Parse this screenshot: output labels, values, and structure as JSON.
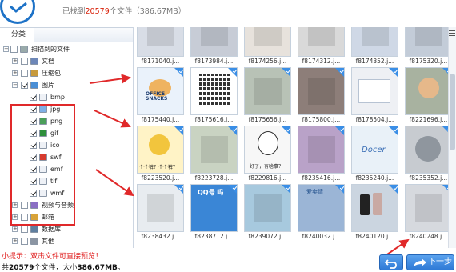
{
  "header": {
    "found_prefix": "已找到",
    "found_count": "20579",
    "found_suffix": "个文件（386.67MB）"
  },
  "sidebar": {
    "tab_label": "分类",
    "root": {
      "label": "扫描到的文件"
    },
    "top_categories": [
      {
        "label": "文档",
        "icon": "document-icon",
        "checked": false
      },
      {
        "label": "压缩包",
        "icon": "archive-icon",
        "checked": false
      },
      {
        "label": "图片",
        "icon": "image-folder-icon",
        "checked": true
      }
    ],
    "image_types": [
      {
        "label": "bmp",
        "icon": "bmp-file-icon",
        "checked": true
      },
      {
        "label": "jpg",
        "icon": "jpg-file-icon",
        "checked": true
      },
      {
        "label": "png",
        "icon": "png-file-icon",
        "checked": true
      },
      {
        "label": "gif",
        "icon": "gif-file-icon",
        "checked": true
      },
      {
        "label": "ico",
        "icon": "ico-file-icon",
        "checked": true
      },
      {
        "label": "swf",
        "icon": "swf-file-icon",
        "checked": true
      },
      {
        "label": "emf",
        "icon": "emf-file-icon",
        "checked": true
      },
      {
        "label": "tif",
        "icon": "tif-file-icon",
        "checked": true
      },
      {
        "label": "wmf",
        "icon": "wmf-file-icon",
        "checked": true
      }
    ],
    "bottom_categories": [
      {
        "label": "视频与音频",
        "icon": "media-icon",
        "checked": false
      },
      {
        "label": "邮箱",
        "icon": "mail-icon",
        "checked": false
      },
      {
        "label": "数据库",
        "icon": "database-icon",
        "checked": false
      },
      {
        "label": "其他",
        "icon": "other-icon",
        "checked": false
      }
    ]
  },
  "gallery": {
    "rows": [
      [
        "f8171040.j...",
        "f8173984.j...",
        "f8174256.j...",
        "f8174312.j...",
        "f8174352.j...",
        "f8175320.j..."
      ],
      [
        "f8175440.j...",
        "f8175616.j...",
        "f8175656.j...",
        "f8175800.j...",
        "f8178504.j...",
        "f8221696.j..."
      ],
      [
        "f8223520.j...",
        "f8223728.j...",
        "f8229816.j...",
        "f8235416.j...",
        "f8235240.j...",
        "f8235352.j..."
      ],
      [
        "f8238432.j...",
        "f8238712.j...",
        "f8239072.j...",
        "f8240032.j...",
        "f8240120.j...",
        "f8240248.j..."
      ]
    ],
    "thumb_texts": {
      "office_snacks": "OFFICE SNACKS",
      "meme_caption": "个个裤？个个裤？",
      "meme_caption2": "好了，有啥事？",
      "qq_text": "QQ号 吗",
      "sign_text": "爱卖情",
      "docer_text": "Docer"
    }
  },
  "footer": {
    "tip": "小提示：双击文件可直接预览！",
    "summary_prefix": "共",
    "summary_count": "20579",
    "summary_mid": "个文件，大小",
    "summary_size": "386.67MB",
    "summary_end": "。",
    "next_label": "下一步"
  },
  "colors": {
    "accent": "#2f7ad6",
    "highlight_box": "#e0292a",
    "tip": "#e02020"
  }
}
